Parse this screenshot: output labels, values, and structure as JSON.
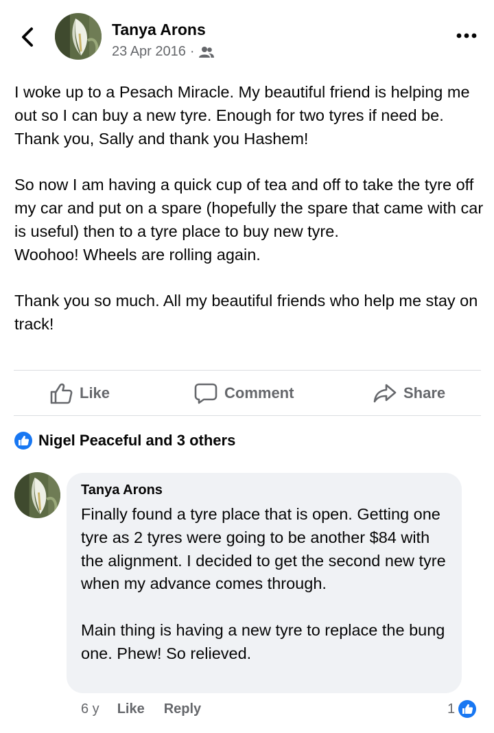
{
  "post": {
    "author": "Tanya Arons",
    "date": "23 Apr 2016",
    "separator": "·",
    "audience_icon": "friends-icon",
    "body": "I woke up to a Pesach Miracle.  My beautiful friend is helping me out so I can buy a new tyre.  Enough for two tyres if need be.  Thank you, Sally and thank you Hashem!\n\nSo now I am having a quick cup of tea and off to take the tyre off my car and put on a spare (hopefully the spare that came with car is useful) then to a tyre place to buy new tyre.\nWoohoo!  Wheels are rolling again.\n\nThank you so much.  All my beautiful friends who help me stay on track!"
  },
  "actions": {
    "like": "Like",
    "comment": "Comment",
    "share": "Share"
  },
  "reactions": {
    "summary": "Nigel Peaceful and 3 others"
  },
  "comment": {
    "author": "Tanya Arons",
    "text": "Finally found a tyre place that is open.  Getting one tyre as 2 tyres were going to be another $84 with the alignment.  I decided to get the second new tyre when my advance comes through.\n\nMain thing is having a new tyre to replace the bung one.  Phew!  So relieved.",
    "age": "6 y",
    "like_label": "Like",
    "reply_label": "Reply",
    "reaction_count": "1"
  },
  "colors": {
    "text_primary": "#050505",
    "text_secondary": "#65676b",
    "like_blue": "#1877f2",
    "bubble_bg": "#f0f2f5",
    "divider": "#dadde1"
  }
}
